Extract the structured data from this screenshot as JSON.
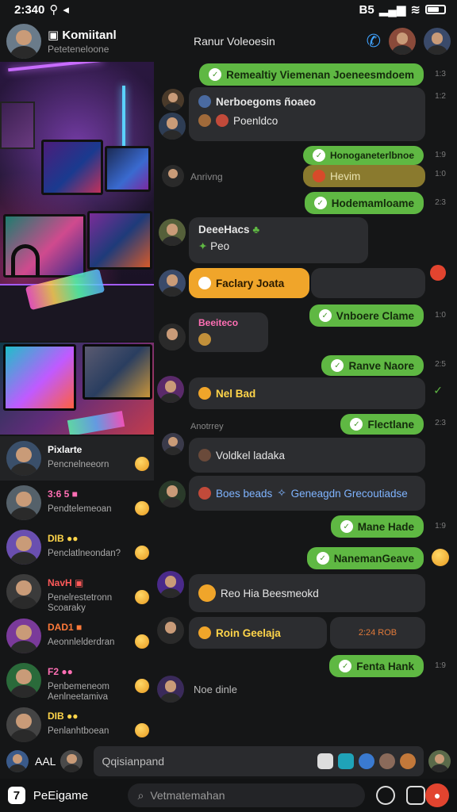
{
  "status": {
    "time": "2:340",
    "nav_glyph": "◂",
    "signal_label": "B5",
    "wifi_glyph": "≋"
  },
  "header": {
    "title": "▣ Komiitanl",
    "subtitle": "Peteteneloone",
    "center": "Ranur Voleoesin"
  },
  "chat_list": [
    {
      "name": "Pixlarte",
      "preview": "Pencnelneeorn",
      "name_color": "#ffffff",
      "avatar_color": "#3a4f6a"
    },
    {
      "name": "3:6 5 ■",
      "preview": "Pendtelemeoan",
      "name_color": "#ff6fb4",
      "avatar_color": "#55616a"
    },
    {
      "name": "DIB ●●",
      "preview": "Penclatlneondan?",
      "name_color": "#ffd54a",
      "avatar_color": "#6a4fb0"
    },
    {
      "name": "NavH ▣",
      "preview": "Penelrestetronn Scoaraky",
      "name_color": "#ff5a5a",
      "avatar_color": "#3b3b3b"
    },
    {
      "name": "DAD1 ■",
      "preview": "Aeonnlelderdran",
      "name_color": "#ff7a3a",
      "avatar_color": "#7a3a9a"
    },
    {
      "name": "F2 ●●",
      "preview": "Penbemeneom Aenlneetamiva",
      "name_color": "#ff6fb4",
      "avatar_color": "#2a6a3a"
    },
    {
      "name": "DIB ●●",
      "preview": "Penlanhtboean",
      "name_color": "#ffd54a",
      "avatar_color": "#444444"
    }
  ],
  "messages": [
    {
      "dir": "out",
      "text": "Remealtiy Viemenan Joeneesmdoem",
      "time": "1:3"
    },
    {
      "dir": "in",
      "text": "Nerboegoms ñoaeo",
      "text2": "Poenldco",
      "time": "1:2"
    },
    {
      "dir": "out",
      "text": "Honoganeterlbnoe",
      "time": "1:9"
    },
    {
      "dir": "in",
      "label": "Anrivng",
      "text": "Hevim",
      "time": "1:0"
    },
    {
      "dir": "out",
      "text": "Hodemamloame",
      "time": "2:3"
    },
    {
      "dir": "in",
      "text": "DeeeHacs",
      "text2": "Peo",
      "time": ""
    },
    {
      "dir": "in",
      "text": "Faclary Joata",
      "time": ""
    },
    {
      "dir": "out",
      "text": "Vnboere Clame",
      "time": "1:0"
    },
    {
      "dir": "in",
      "text": "Beeiteco",
      "time": ""
    },
    {
      "dir": "out",
      "text": "Ranve Naore",
      "time": "2:5"
    },
    {
      "dir": "in",
      "text": "Nel Bad",
      "time": ""
    },
    {
      "dir": "in",
      "label": "Anotrrey",
      "time": ""
    },
    {
      "dir": "out",
      "text": "Flectlane",
      "time": "2:3"
    },
    {
      "dir": "in",
      "text": "Voldkel ladaka",
      "time": ""
    },
    {
      "dir": "in",
      "text": "Boes beads",
      "text2": "Geneagdn Grecoutiadse",
      "time": ""
    },
    {
      "dir": "out",
      "text": "Mane Hade",
      "time": "1:9"
    },
    {
      "dir": "out",
      "text": "NanemanGeave",
      "time": ""
    },
    {
      "dir": "in",
      "text": "Reo Hia Beesmeokd",
      "time": ""
    },
    {
      "dir": "in",
      "text": "Roin Geelaja",
      "right": "2:24 ROB",
      "time": ""
    },
    {
      "dir": "out",
      "text": "Fenta Hank",
      "time": "1:9"
    },
    {
      "dir": "in",
      "text": "Noe dinle",
      "time": ""
    }
  ],
  "composer": {
    "label": "AAL",
    "placeholder": "Qqisianpand"
  },
  "bottom": {
    "app_name": "PeEigame",
    "search_placeholder": "Vetmatemahan",
    "app_glyph": "7"
  },
  "colors": {
    "accent_green": "#5fb843",
    "accent_orange": "#f0a52a",
    "background": "#151617",
    "bubble_in": "#2c2d30"
  },
  "icons": [
    "back-icon",
    "location-icon",
    "signal-icon",
    "wifi-icon",
    "battery-icon",
    "phone-icon",
    "search-icon",
    "camera-icon",
    "share-icon"
  ]
}
